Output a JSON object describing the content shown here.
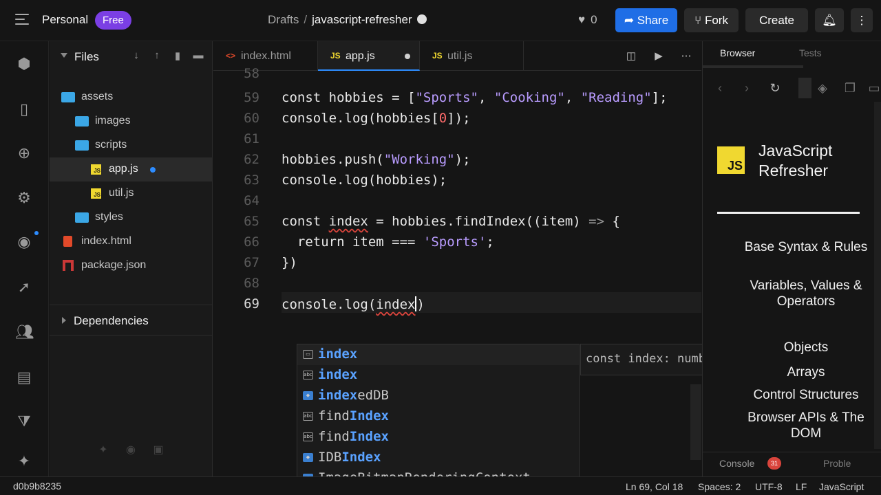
{
  "header": {
    "workspace": "Personal",
    "plan_badge": "Free",
    "breadcrumb_parent": "Drafts",
    "breadcrumb_separator": "/",
    "project_name": "javascript-refresher",
    "likes": "0",
    "share_label": "Share",
    "fork_label": "Fork",
    "create_label": "Create"
  },
  "sidebar": {
    "title": "Files",
    "tree": [
      {
        "label": "assets",
        "type": "folder-open"
      },
      {
        "label": "images",
        "type": "folder"
      },
      {
        "label": "scripts",
        "type": "folder-open"
      },
      {
        "label": "app.js",
        "type": "js",
        "selected": true,
        "modified": true
      },
      {
        "label": "util.js",
        "type": "js"
      },
      {
        "label": "styles",
        "type": "folder"
      },
      {
        "label": "index.html",
        "type": "html"
      },
      {
        "label": "package.json",
        "type": "npm"
      }
    ],
    "dependencies_label": "Dependencies"
  },
  "editor": {
    "tabs": [
      {
        "label": "index.html",
        "icon": "<>"
      },
      {
        "label": "app.js",
        "icon": "JS",
        "active": true,
        "modified": true
      },
      {
        "label": "util.js",
        "icon": "JS"
      }
    ],
    "line_numbers": [
      "58",
      "59",
      "60",
      "61",
      "62",
      "63",
      "64",
      "65",
      "66",
      "67",
      "68",
      "69"
    ],
    "current_line": "69",
    "autocomplete": [
      {
        "kind": "var",
        "match": "index",
        "rest": ""
      },
      {
        "kind": "abc",
        "match": "index",
        "rest": ""
      },
      {
        "kind": "var",
        "match": "index",
        "rest": "edDB"
      },
      {
        "kind": "abc",
        "pre": "find",
        "match": "Index",
        "rest": ""
      },
      {
        "kind": "abc",
        "pre": "find",
        "match": "Index",
        "rest": ""
      },
      {
        "kind": "var",
        "pre": "IDB",
        "match": "Index",
        "rest": ""
      },
      {
        "kind": "var",
        "pre": "ImageBitmapRenderingContext",
        "match": "",
        "rest": ""
      }
    ],
    "hover_doc": "const index: number"
  },
  "preview": {
    "tab_browser": "Browser",
    "tab_tests": "Tests",
    "logo_text": "JS",
    "page_title": "JavaScript Refresher",
    "toc": [
      "Base Syntax & Rules",
      "Variables, Values & Operators",
      "Objects",
      "Arrays",
      "Control Structures",
      "Browser APIs & The DOM"
    ],
    "console_label": "Console",
    "console_count": "31",
    "problems_label": "Proble"
  },
  "status": {
    "commit": "d0b9b8235",
    "position": "Ln 69, Col 18",
    "spaces": "Spaces: 2",
    "encoding": "UTF-8",
    "eol": "LF",
    "language": "JavaScript"
  },
  "colors": {
    "accent": "#1f6ee6",
    "badge": "#7b3fe4",
    "string": "#b99cff",
    "number": "#ff6b6b",
    "match": "#5aa2ff",
    "js_yellow": "#f0d830"
  }
}
